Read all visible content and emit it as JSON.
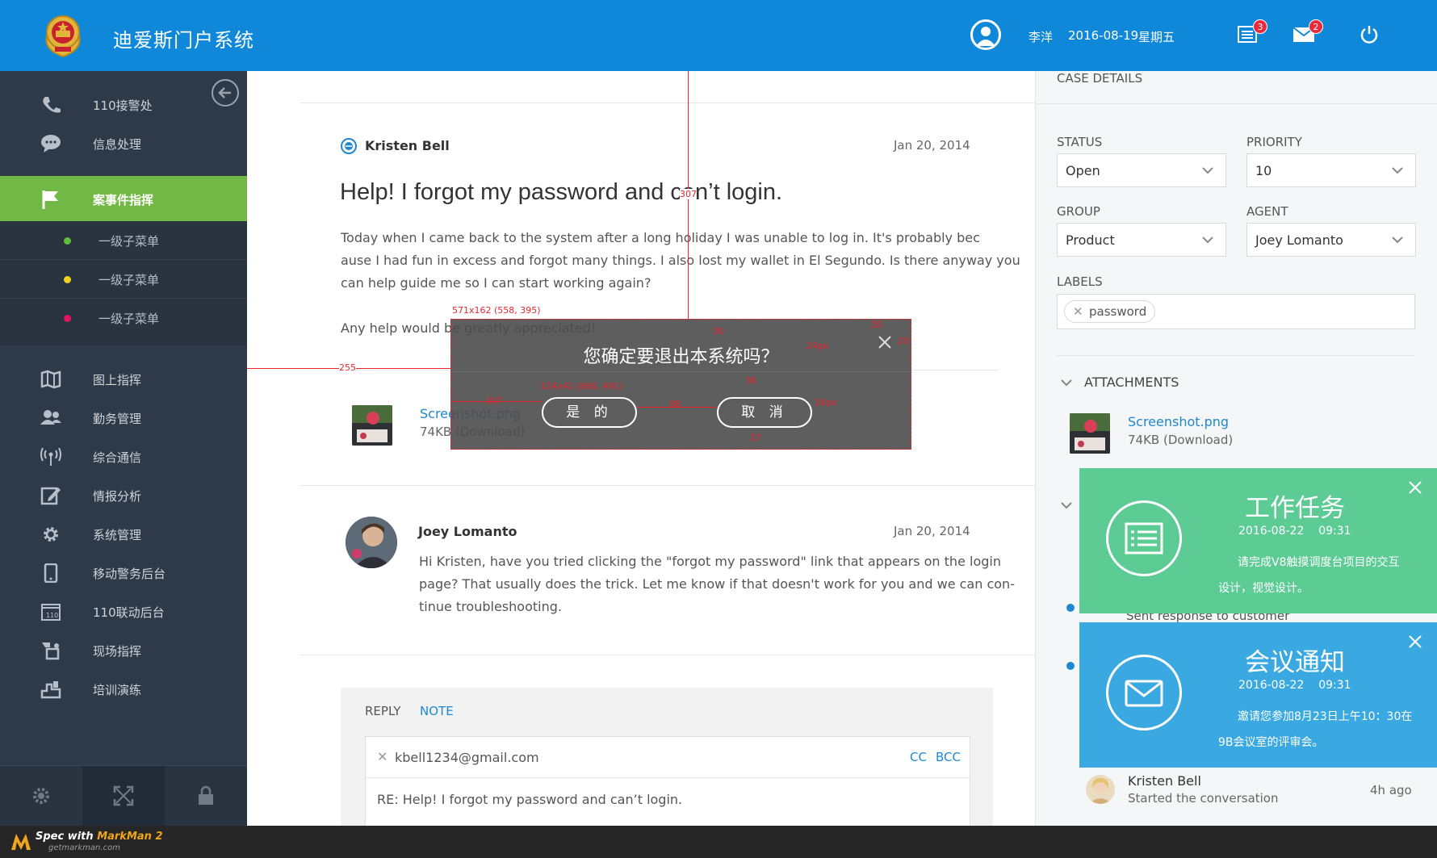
{
  "header": {
    "app_title": "迪爱斯门户系统",
    "user_name": "李洋",
    "date": "2016-08-19",
    "weekday": "星期五",
    "tasks_badge": "3",
    "mail_badge": "2",
    "icons": [
      "police-emblem-icon",
      "user-icon",
      "task-list-icon",
      "mail-icon",
      "power-icon"
    ]
  },
  "sidebar": {
    "items": [
      {
        "label": "110接警处",
        "icon": "phone-icon"
      },
      {
        "label": "信息处理",
        "icon": "chat-icon"
      },
      {
        "label": "案事件指挥",
        "icon": "flag-icon"
      },
      {
        "label": "图上指挥",
        "icon": "map-icon"
      },
      {
        "label": "勤务管理",
        "icon": "people-icon"
      },
      {
        "label": "综合通信",
        "icon": "antenna-icon"
      },
      {
        "label": "情报分析",
        "icon": "edit-icon"
      },
      {
        "label": "系统管理",
        "icon": "gear-icon"
      },
      {
        "label": "移动警务后台",
        "icon": "mobile-icon"
      },
      {
        "label": "110联动后台",
        "icon": "calendar-110-icon"
      },
      {
        "label": "现场指挥",
        "icon": "scene-icon"
      },
      {
        "label": "培训演练",
        "icon": "training-icon"
      }
    ],
    "sub_items": [
      {
        "label": "一级子菜单",
        "color": "#5cc03a"
      },
      {
        "label": "一级子菜单",
        "color": "#f3d11a"
      },
      {
        "label": "一级子菜单",
        "color": "#e8125d"
      }
    ]
  },
  "thread": {
    "msg1": {
      "author": "Kristen Bell",
      "date": "Jan 20, 2014",
      "title": "Help! I forgot my password and can’t login.",
      "body_lines": [
        "Today when I came back to the system after a long holiday I was unable to log in. It's probably bec",
        "ause I had fun in excess and forgot many things. I also lost my wallet in El Segundo. Is there anyway you",
        "can help guide me so I can start working again?"
      ],
      "body_last": "Any help would be greatly appreciated!",
      "attachment_name": "Screenshot.png",
      "attachment_size": "74KB (Download)"
    },
    "msg2": {
      "author": "Joey Lomanto",
      "date": "Jan 20, 2014",
      "body_lines": [
        "Hi Kristen, have you tried clicking the \"forgot my password\" link that appears on the login",
        "page? That usually does the trick. Let me know if that doesn't work for you and we can con-",
        "tinue troubleshooting."
      ]
    },
    "reply": {
      "tab_reply": "REPLY",
      "tab_note": "NOTE",
      "to": "kbell1234@gmail.com",
      "cc": "CC",
      "bcc": "BCC",
      "subject": "RE: Help! I forgot my password and can’t login."
    }
  },
  "dialog": {
    "question": "您确定要退出本系统吗？",
    "confirm": "是 的",
    "cancel": "取 消"
  },
  "spec": {
    "dialog_size": "571x162 (558, 395)",
    "button_size": "124x41 (666, 491)",
    "v_307": "307",
    "left_255": "255",
    "top_30": "30",
    "close_20a": "20",
    "close_20b": "20",
    "font_24": "24px",
    "gap_36": "36",
    "left_107": "107",
    "gap_98": "98",
    "font_16": "16px",
    "bottom_27": "27"
  },
  "right_panel": {
    "section_title": "CASE DETAILS",
    "status_label": "STATUS",
    "status_value": "Open",
    "priority_label": "PRIORITY",
    "priority_value": "10",
    "group_label": "GROUP",
    "group_value": "Product",
    "agent_label": "AGENT",
    "agent_value": "Joey Lomanto",
    "labels_label": "LABELS",
    "label_chip": "password",
    "attachments_title": "ATTACHMENTS",
    "attachment_name": "Screenshot.png",
    "attachment_size": "74KB (Download)",
    "activity_partial": "Sent response to customer",
    "activity_author": "Kristen Bell",
    "activity_text": "Started the conversation",
    "activity_time": "4h ago"
  },
  "notifications": [
    {
      "title": "工作任务",
      "date": "2016-08-22",
      "time": "09:31",
      "body1": "请完成V8触摸调度台项目的交互",
      "body2": "设计，视觉设计。",
      "color": "#5ccb94",
      "icon": "task-list-icon"
    },
    {
      "title": "会议通知",
      "date": "2016-08-22",
      "time": "09:31",
      "body1": "邀请您参加8月23日上午10：30在",
      "body2": "9B会议室的评审会。",
      "color": "#3aa9e1",
      "icon": "mail-icon"
    }
  ],
  "footer": {
    "brand_prefix": "Spec with",
    "brand_name": "MarkMan 2",
    "brand_url": "getmarkman.com"
  }
}
